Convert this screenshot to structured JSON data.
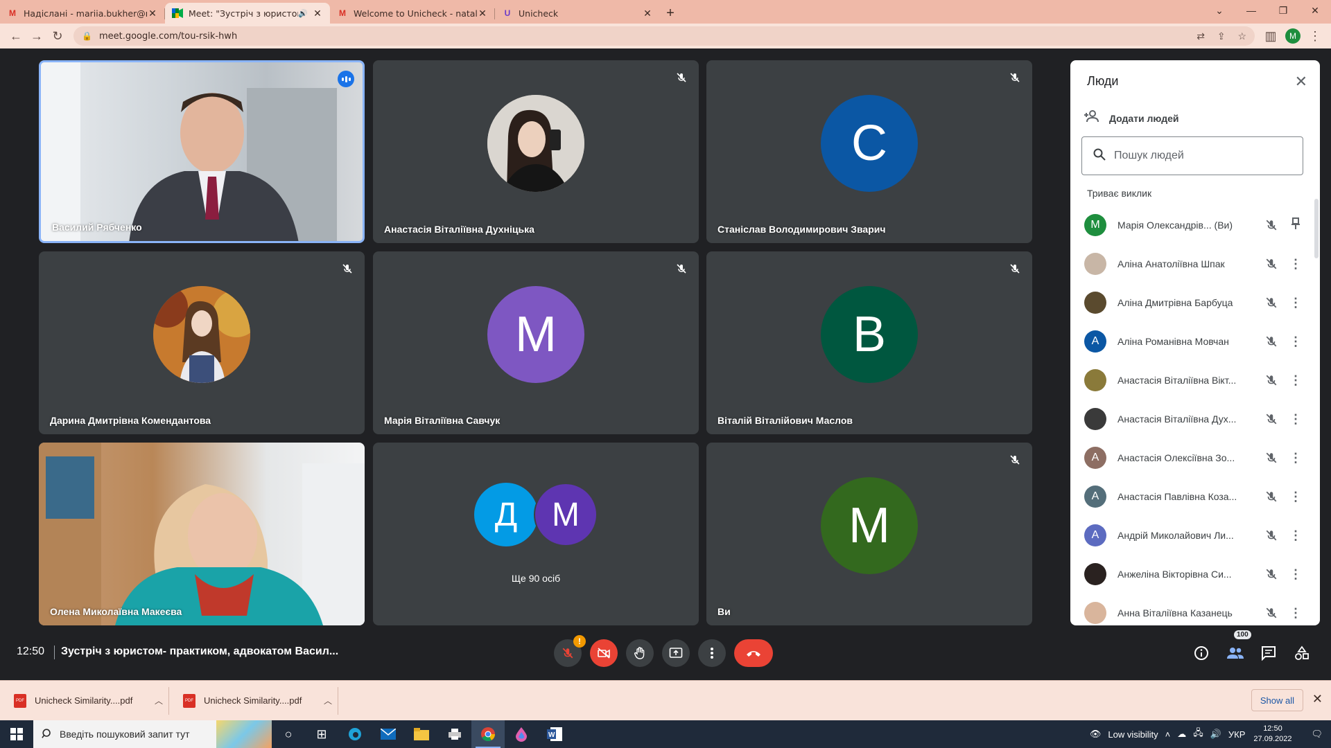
{
  "browser": {
    "tabs": [
      {
        "title": "Надіслані - mariia.bukher@npp.",
        "icon": "gmail-icon",
        "active": false
      },
      {
        "title": "Meet: \"Зустріч з юристом- п",
        "icon": "meet-icon",
        "active": true
      },
      {
        "title": "Welcome to Unicheck - nataliia.p",
        "icon": "gmail-icon",
        "active": false
      },
      {
        "title": "Unicheck",
        "icon": "unicheck-icon",
        "active": false
      }
    ],
    "new_tab": "+",
    "url": "meet.google.com/tou-rsik-hwh",
    "profile_initial": "M"
  },
  "tiles": [
    {
      "name": "Василий Рябченко",
      "type": "video",
      "speaking": true
    },
    {
      "name": "Анастасія Віталіївна Духніцька",
      "type": "photo",
      "muted": true
    },
    {
      "name": "Станіслав Володимирович Зварич",
      "type": "initial",
      "initial": "С",
      "color": "#0b57a4",
      "muted": true
    },
    {
      "name": "Дарина Дмитрівна Комендантова",
      "type": "photo",
      "muted": true
    },
    {
      "name": "Марія Віталіївна Савчук",
      "type": "initial",
      "initial": "М",
      "color": "#7e57c2",
      "muted": true
    },
    {
      "name": "Віталій Віталійович Маслов",
      "type": "initial",
      "initial": "В",
      "color": "#00573f",
      "muted": true
    },
    {
      "name": "Олена Миколаївна Макеєва",
      "type": "video"
    },
    {
      "name": "",
      "type": "others",
      "initials": [
        "Д",
        "М"
      ],
      "caption": "Ще 90 осіб"
    },
    {
      "name": "Ви",
      "type": "initial",
      "initial": "M",
      "color": "#33691e",
      "muted": true
    }
  ],
  "people_panel": {
    "title": "Люди",
    "add_people": "Додати людей",
    "search_placeholder": "Пошук людей",
    "section_label": "Триває виклик",
    "participants": [
      {
        "name": "Марія Олександрів...",
        "suffix": "(Ви)",
        "initial": "M",
        "color": "#1e8e3e",
        "action": "pin-icon"
      },
      {
        "name": "Аліна Анатоліївна Шпак",
        "initial": "",
        "color": "#c8b6a6",
        "action": "more-icon"
      },
      {
        "name": "Аліна Дмитрівна Барбуца",
        "initial": "",
        "color": "#5a4a2e",
        "action": "more-icon"
      },
      {
        "name": "Аліна Романівна Мовчан",
        "initial": "А",
        "color": "#0b57a4",
        "action": "more-icon"
      },
      {
        "name": "Анастасія Віталіївна Вікт...",
        "initial": "",
        "color": "#8a7a3a",
        "action": "more-icon"
      },
      {
        "name": "Анастасія Віталіївна Дух...",
        "initial": "",
        "color": "#3a3a3a",
        "action": "more-icon"
      },
      {
        "name": "Анастасія Олексіївна Зо...",
        "initial": "А",
        "color": "#8d6e63",
        "action": "more-icon"
      },
      {
        "name": "Анастасія Павлівна Коза...",
        "initial": "А",
        "color": "#546e7a",
        "action": "more-icon"
      },
      {
        "name": "Андрій Миколайович Ли...",
        "initial": "А",
        "color": "#5c6bc0",
        "action": "more-icon"
      },
      {
        "name": "Анжеліна Вікторівна Си...",
        "initial": "",
        "color": "#2a2220",
        "action": "more-icon"
      },
      {
        "name": "Анна Віталіївна Казанець",
        "initial": "",
        "color": "#d9b59c",
        "action": "more-icon"
      }
    ]
  },
  "controls": {
    "time": "12:50",
    "meeting_title": "Зустріч з юристом- практиком, адвокатом Васил...",
    "participants_count": "100",
    "warning_badge": "!"
  },
  "downloads": {
    "items": [
      "Unicheck Similarity....pdf",
      "Unicheck Similarity....pdf"
    ],
    "pdf_label": "PDF",
    "show_all": "Show all"
  },
  "taskbar": {
    "search_placeholder": "Введіть пошуковий запит тут",
    "visibility": "Low visibility",
    "lang": "УКР",
    "time": "12:50",
    "date": "27.09.2022"
  }
}
